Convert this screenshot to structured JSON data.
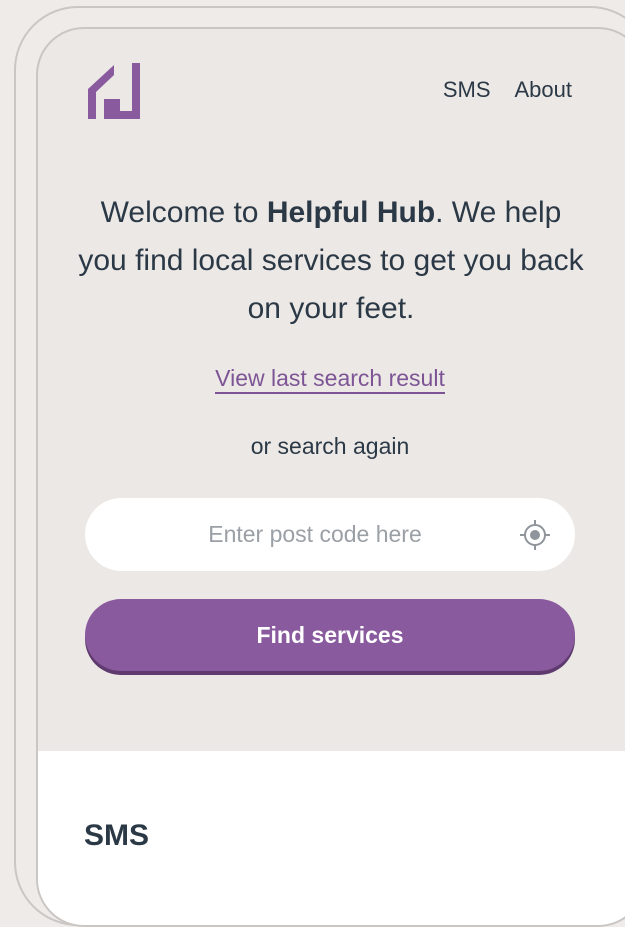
{
  "nav": {
    "items": [
      {
        "label": "SMS"
      },
      {
        "label": "About"
      }
    ]
  },
  "welcome": {
    "prefix": "Welcome to ",
    "brand": "Helpful Hub",
    "suffix": ". We help you find local services to get you back on your feet."
  },
  "last_search": {
    "link_label": "View last search result"
  },
  "search": {
    "or_text": "or search again",
    "placeholder": "Enter post code here",
    "value": "",
    "locate_icon": "location-target-icon"
  },
  "find_button": {
    "label": "Find services"
  },
  "section": {
    "title": "SMS"
  },
  "colors": {
    "brand": "#8a5a9e",
    "text": "#2b3947",
    "background": "#ece8e5"
  },
  "logo": {
    "icon": "house-logo-icon"
  }
}
